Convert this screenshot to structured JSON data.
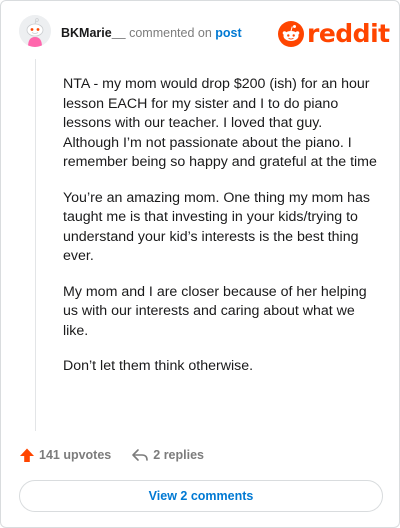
{
  "header": {
    "username": "BKMarie__",
    "commented_on": "commented on",
    "post_link": "post",
    "logo_word": "reddit"
  },
  "comment": {
    "paragraphs": [
      "NTA - my mom would drop $200 (ish) for an hour lesson EACH for my sister and I to do piano lessons with our teacher. I loved that guy. Although I’m not passionate about the piano. I remember being so happy and grateful at the time",
      "You’re an amazing mom. One thing my mom has taught me is that investing in your kids/trying to understand your kid’s interests is the best thing ever.",
      "My mom and I are closer because of her helping us with our interests and caring about what we like.",
      "Don’t let them think otherwise."
    ]
  },
  "actions": {
    "upvotes": "141 upvotes",
    "replies": "2 replies"
  },
  "footer": {
    "view_comments": "View 2 comments"
  },
  "icons": {
    "avatar": "snoo-avatar-icon",
    "logo": "reddit-snoo-logo-icon",
    "upvote": "upvote-arrow-icon",
    "reply": "reply-arrow-icon"
  },
  "colors": {
    "brand": "#ff4500",
    "link": "#0079d3",
    "text": "#1a1a1b",
    "muted": "#7c7c7c",
    "border": "#d9dcde"
  }
}
